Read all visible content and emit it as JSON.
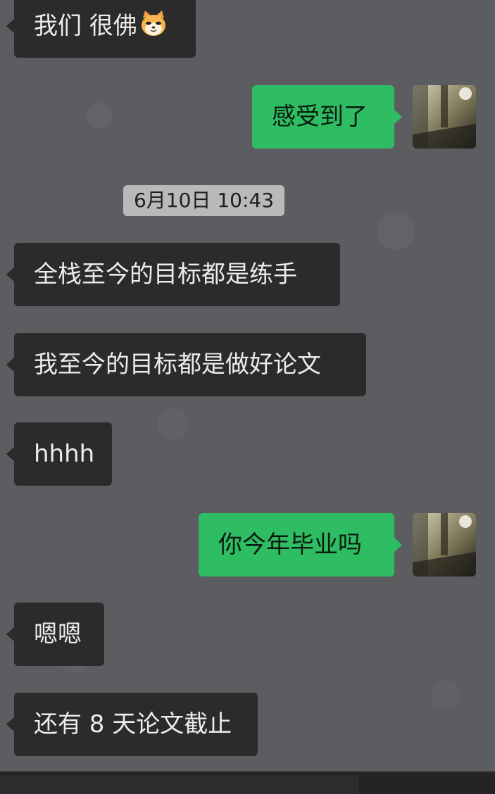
{
  "conversation": {
    "messages": [
      {
        "side": "in",
        "text_main": "我们 很佛",
        "emoji": "doge-cat-emoji"
      },
      {
        "side": "out",
        "text": "感受到了"
      },
      {
        "side": "in",
        "text": "全栈至今的目标都是练手"
      },
      {
        "side": "in",
        "text": "我至今的目标都是做好论文"
      },
      {
        "side": "in",
        "text": "hhhh"
      },
      {
        "side": "out",
        "text": "你今年毕业吗"
      },
      {
        "side": "in",
        "text": "嗯嗯"
      },
      {
        "side": "in",
        "text": "还有 8 天论文截止"
      }
    ],
    "timestamp": "6月10日 10:43"
  },
  "colors": {
    "background": "#5b5d60",
    "incoming_bubble": "#2b2b2c",
    "outgoing_bubble": "#2fbd63",
    "timestamp_pill": "#b9b9ba"
  }
}
